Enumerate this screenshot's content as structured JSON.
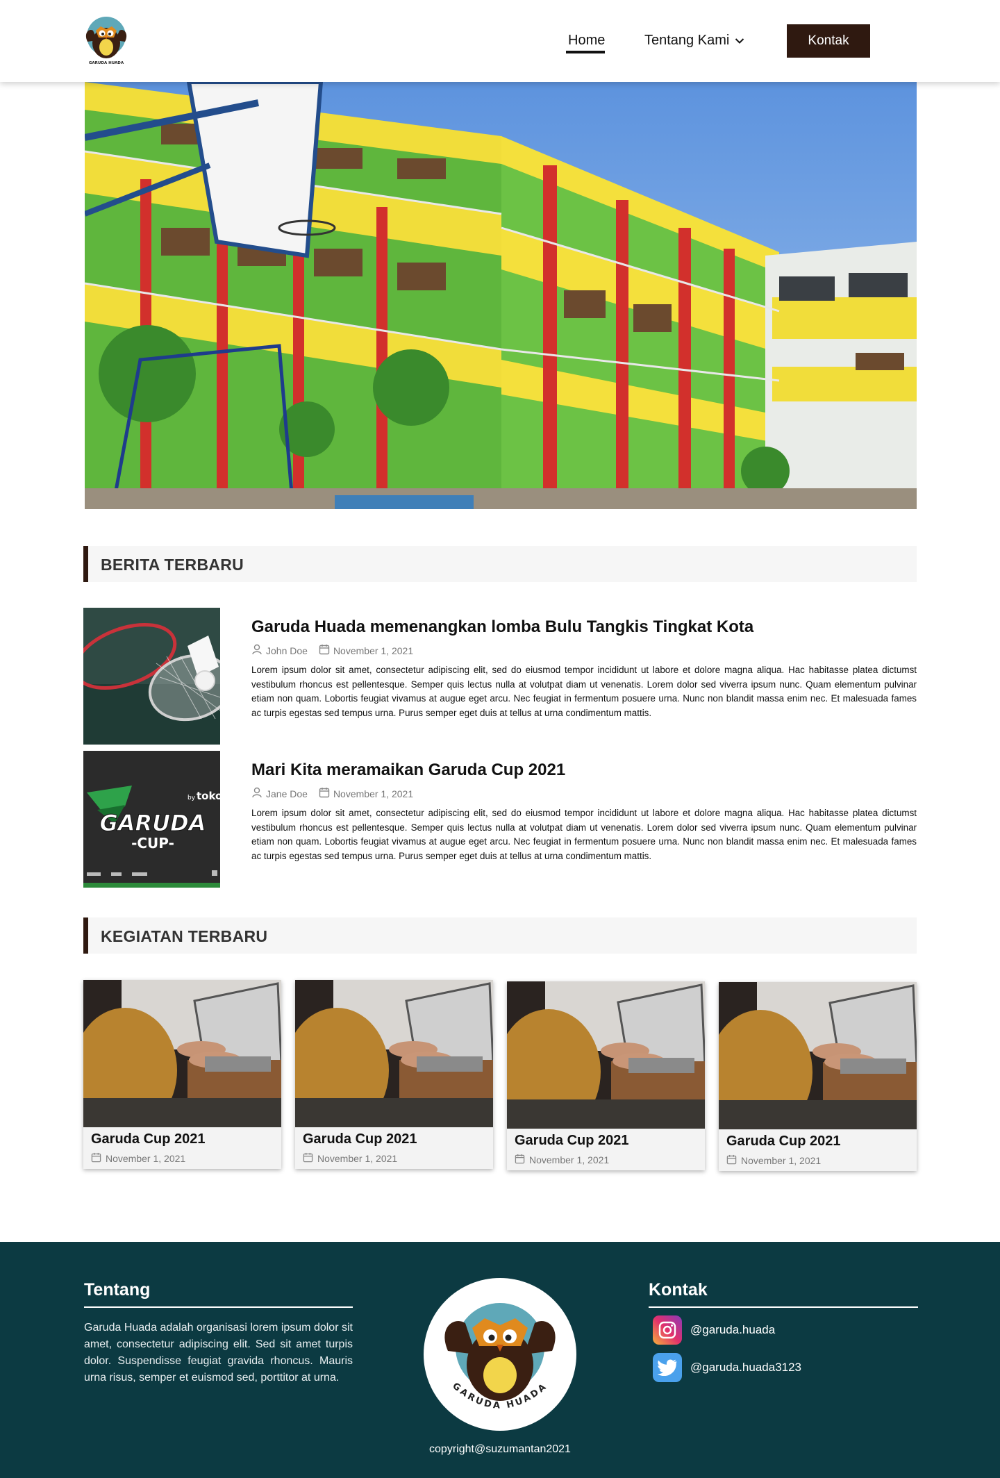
{
  "header": {
    "logo_text": "GARUDA HUADA",
    "nav": {
      "home": "Home",
      "about": "Tentang Kami",
      "contact": "Kontak"
    }
  },
  "news_section": {
    "title": "BERITA TERBARU",
    "items": [
      {
        "title": "Garuda Huada memenangkan lomba Bulu Tangkis Tingkat Kota",
        "author": "John Doe",
        "date": "November 1, 2021",
        "body": "Lorem ipsum dolor sit amet, consectetur adipiscing elit, sed do eiusmod tempor incididunt ut labore et dolore magna aliqua. Hac habitasse platea dictumst vestibulum rhoncus est pellentesque. Semper quis lectus nulla at volutpat diam ut venenatis. Lorem dolor sed viverra ipsum nunc. Quam elementum pulvinar etiam non quam. Lobortis feugiat vivamus at augue eget arcu. Nec feugiat in fermentum posuere urna. Nunc non blandit massa enim nec. Et malesuada fames ac turpis egestas sed tempus urna. Purus semper eget duis at tellus at urna condimentum mattis."
      },
      {
        "title": "Mari Kita meramaikan Garuda Cup 2021",
        "author": "Jane Doe",
        "date": "November 1, 2021",
        "body": "Lorem ipsum dolor sit amet, consectetur adipiscing elit, sed do eiusmod tempor incididunt ut labore et dolore magna aliqua. Hac habitasse platea dictumst vestibulum rhoncus est pellentesque. Semper quis lectus nulla at volutpat diam ut venenatis. Lorem dolor sed viverra ipsum nunc. Quam elementum pulvinar etiam non quam. Lobortis feugiat vivamus at augue eget arcu. Nec feugiat in fermentum posuere urna. Nunc non blandit massa enim nec. Et malesuada fames ac turpis egestas sed tempus urna. Purus semper eget duis at tellus at urna condimentum mattis."
      }
    ],
    "poster": {
      "brand": "tokopedia",
      "brand_prefix": "by",
      "title_line1": "GARUDA",
      "title_line2": "-CUP-"
    }
  },
  "activities_section": {
    "title": "KEGIATAN TERBARU",
    "cards": [
      {
        "title": "Garuda Cup 2021",
        "date": "November 1, 2021"
      },
      {
        "title": "Garuda Cup 2021",
        "date": "November 1, 2021"
      },
      {
        "title": "Garuda Cup 2021",
        "date": "November 1, 2021"
      },
      {
        "title": "Garuda Cup 2021",
        "date": "November 1, 2021"
      }
    ]
  },
  "footer": {
    "about_title": "Tentang",
    "about_text": "Garuda Huada adalah organisasi lorem ipsum dolor sit amet, consectetur adipiscing elit. Sed sit amet turpis dolor. Suspendisse feugiat gravida rhoncus. Mauris urna risus, semper et euismod sed, porttitor at urna.",
    "contact_title": "Kontak",
    "instagram": "@garuda.huada",
    "twitter": "@garuda.huada3123",
    "logo_text": "GARUDA HUADA",
    "copyright": "copyright@suzumantan2021"
  },
  "colors": {
    "brand_brown": "#2f1910",
    "footer_bg": "#0c3a42",
    "section_bg": "#f6f6f6"
  }
}
